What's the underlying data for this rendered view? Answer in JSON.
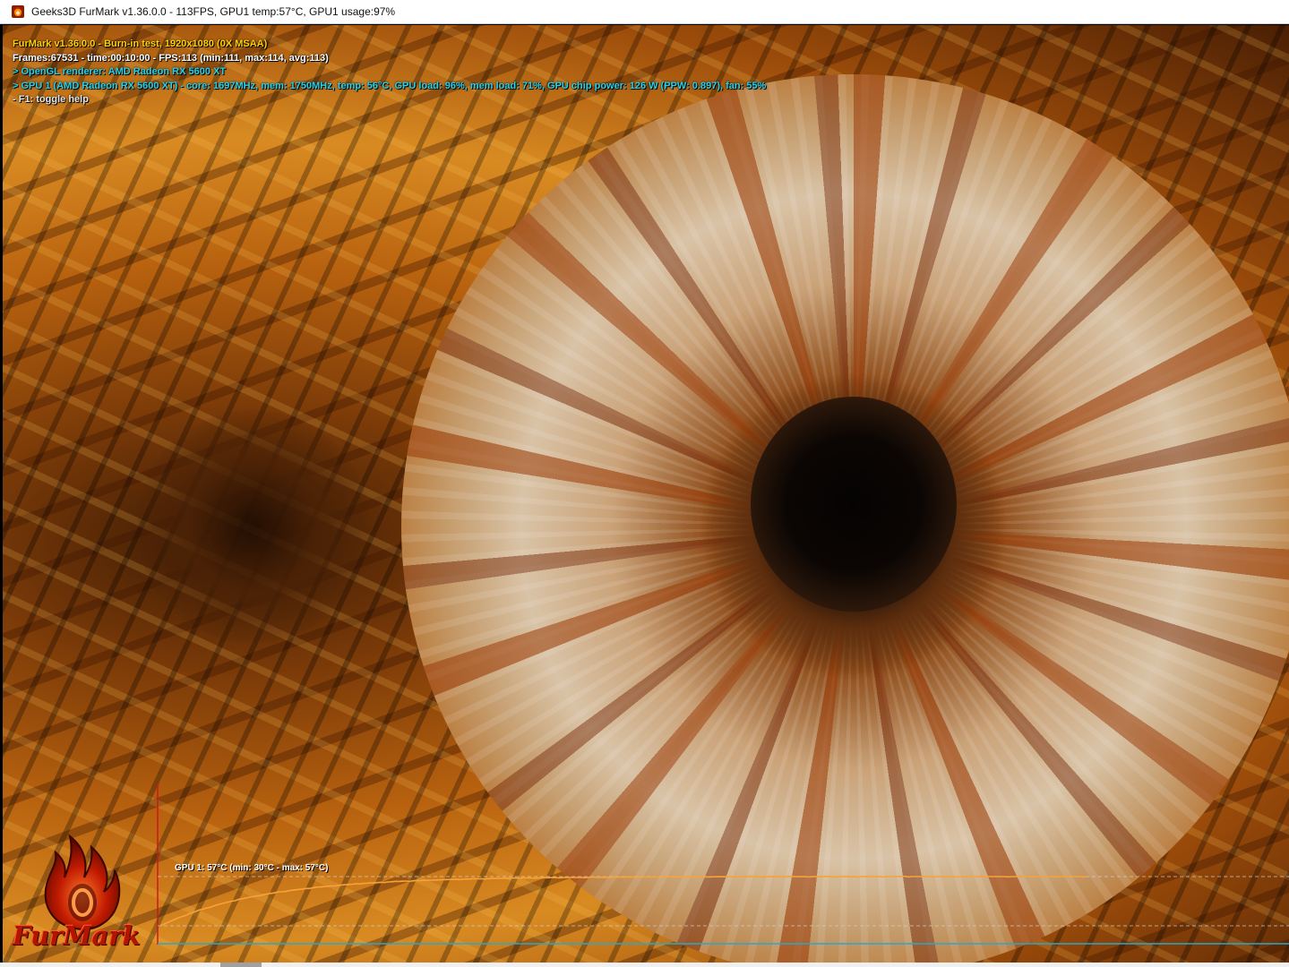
{
  "window": {
    "title": "Geeks3D FurMark v1.36.0.0 - 113FPS, GPU1 temp:57°C, GPU1 usage:97%"
  },
  "overlay": {
    "lines": [
      {
        "text": "FurMark v1.36.0.0 - Burn-in test, 1920x1080 (0X MSAA)",
        "color": "#ffd200"
      },
      {
        "text": "Frames:67531 - time:00:10:00 - FPS:113 (min:111, max:114, avg:113)",
        "color": "#ffffff"
      },
      {
        "text": "> OpenGL renderer: AMD Radeon RX 5600 XT",
        "color": "#22d3ee"
      },
      {
        "text": "> GPU 1 (AMD Radeon RX 5600 XT) - core: 1697MHz, mem: 1750MHz, temp: 56°C, GPU load: 96%, mem load: 71%, GPU chip power: 126 W (PPW: 0.897), fan: 55%",
        "color": "#22d3ee"
      },
      {
        "text": "- F1: toggle help",
        "color": "#e6e6e6"
      }
    ]
  },
  "temperature_graph": {
    "label": "GPU 1: 57°C (min: 30°C - max: 57°C)",
    "min_c": 30,
    "max_c": 57,
    "current_c": 57,
    "line_color": "#f7a23a"
  },
  "logo": {
    "text": "FurMark"
  },
  "colors": {
    "accent_orange": "#f7a23a",
    "overlay_cyan": "#22d3ee",
    "overlay_yellow": "#ffd200"
  }
}
